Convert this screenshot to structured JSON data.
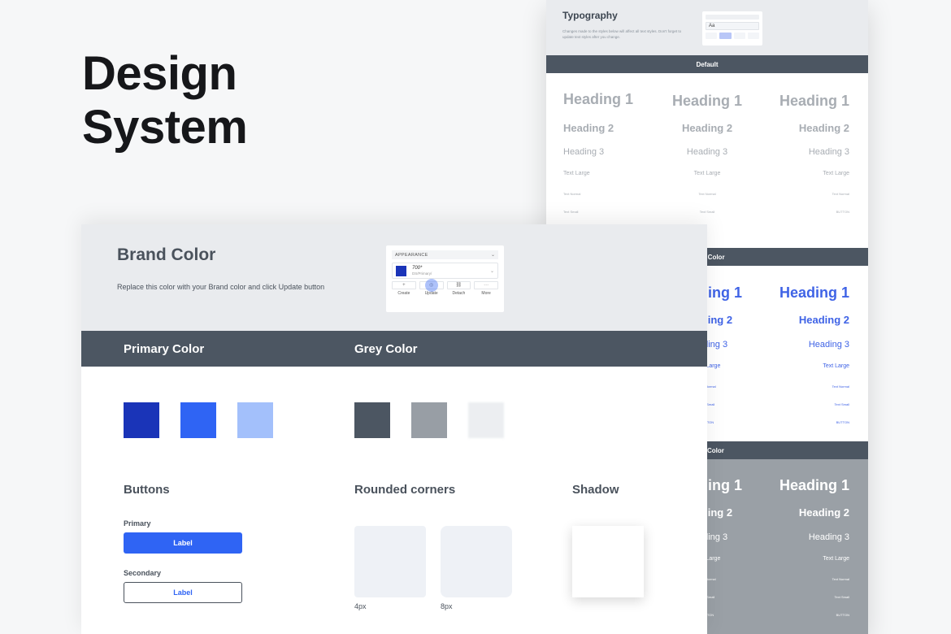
{
  "hero": {
    "line1": "Design",
    "line2": "System"
  },
  "typography_panel": {
    "title": "Typography",
    "description": "Changes made to the styles below will affect all text styles. Don't forget to update text styles after you change.",
    "thumb_value": "Aa",
    "sections": [
      {
        "label": "Default"
      },
      {
        "label": "y Color"
      },
      {
        "label": "Color"
      }
    ],
    "default_columns": [
      {
        "h1": "Heading 1",
        "h2": "Heading 2",
        "h3": "Heading 3",
        "tl": "Text Large",
        "tn": "Text Normal",
        "ts": "Text Small"
      },
      {
        "h1": "Heading 1",
        "h2": "Heading 2",
        "h3": "Heading 3",
        "tl": "Text Large",
        "tn": "Text Normal",
        "ts": "Text Small"
      },
      {
        "h1": "Heading 1",
        "h2": "Heading 2",
        "h3": "Heading 3",
        "tl": "Text Large",
        "tn": "Text Normal",
        "ts": "BUTTON"
      }
    ],
    "primary_columns": [
      {
        "h1": "Heading 1",
        "h2": "Heading 2",
        "h3": "Heading 3",
        "tl": "Text Large",
        "tn": "Text Normal",
        "ts": "Text Small",
        "bt": "BUTTON"
      },
      {
        "h1": "Heading 1",
        "h2": "Heading 2",
        "h3": "Heading 3",
        "tl": "Text Large",
        "tn": "Text Normal",
        "ts": "Text Small",
        "bt": "BUTTON"
      }
    ],
    "grey_columns": [
      {
        "h1": "Heading 1",
        "h2": "Heading 2",
        "h3": "Heading 3",
        "tl": "Text Large",
        "tn": "Text Normal",
        "ts": "Text Small",
        "bt": "BUTTON"
      },
      {
        "h1": "Heading 1",
        "h2": "Heading 2",
        "h3": "Heading 3",
        "tl": "Text Large",
        "tn": "Text Normal",
        "ts": "Text Small",
        "bt": "BUTTON"
      }
    ]
  },
  "brand_panel": {
    "title": "Brand Color",
    "description": "Replace this color with your Brand color and click Update button",
    "appearance": {
      "header": "APPEARANCE",
      "value": "700*",
      "sub": "DS/Primary/",
      "actions": [
        {
          "label": "Create",
          "icon": "+"
        },
        {
          "label": "Update",
          "icon": "◎"
        },
        {
          "label": "Detach",
          "icon": "⛓"
        },
        {
          "label": "More",
          "icon": "···"
        }
      ]
    },
    "bands": {
      "primary": "Primary Color",
      "grey": "Grey Color"
    },
    "primary_swatches": [
      "#1a34b8",
      "#2f64f4",
      "#a3c0fb"
    ],
    "grey_swatches": [
      "#4c5662",
      "#989ea5",
      "#eceef1"
    ],
    "buttons": {
      "title": "Buttons",
      "primary_caption": "Primary",
      "primary_label": "Label",
      "secondary_caption": "Secondary",
      "secondary_label": "Label"
    },
    "rounded": {
      "title": "Rounded corners",
      "small": "4px",
      "large": "8px"
    },
    "shadow": {
      "title": "Shadow"
    }
  },
  "colors": {
    "accent": "#2f64f4",
    "band": "#4c5662",
    "primary_dark": "#1a34b8"
  }
}
